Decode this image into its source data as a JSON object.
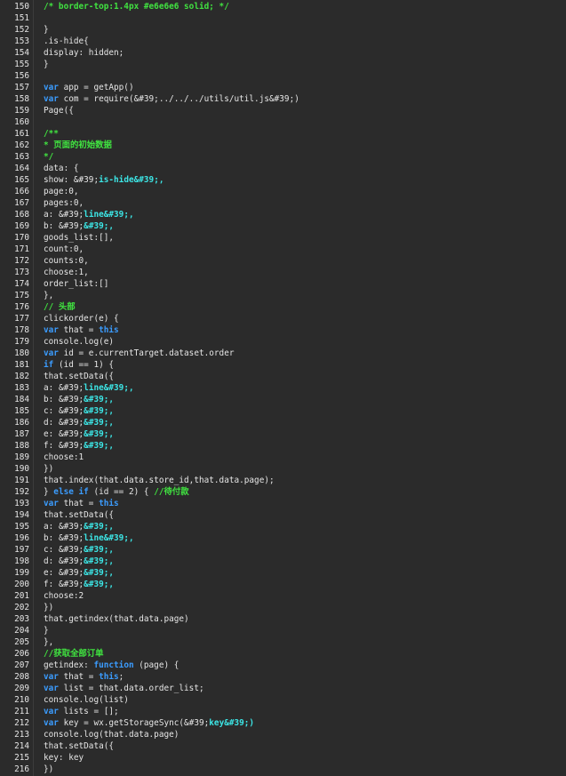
{
  "editor": {
    "colors": {
      "background": "#2b2b2b",
      "text": "#e6e6e6",
      "comment": "#40e340",
      "keyword": "#3b9cff",
      "string": "#3ce6e6"
    },
    "lines": [
      {
        "n": "150",
        "t": [
          [
            "comment",
            "/* border-top:1.4px #e6e6e6 solid; */"
          ]
        ]
      },
      {
        "n": "151",
        "t": []
      },
      {
        "n": "152",
        "t": [
          [
            "plain",
            "}"
          ]
        ]
      },
      {
        "n": "153",
        "t": [
          [
            "plain",
            ".is-hide{"
          ]
        ]
      },
      {
        "n": "154",
        "t": [
          [
            "plain",
            "display: hidden;"
          ]
        ]
      },
      {
        "n": "155",
        "t": [
          [
            "plain",
            "}"
          ]
        ]
      },
      {
        "n": "156",
        "t": []
      },
      {
        "n": "157",
        "t": [
          [
            "kw",
            "var"
          ],
          [
            "plain",
            " app = getApp()"
          ]
        ]
      },
      {
        "n": "158",
        "t": [
          [
            "kw",
            "var"
          ],
          [
            "plain",
            " com = require(&#39;../../../utils/util.js&#39;)"
          ]
        ]
      },
      {
        "n": "159",
        "t": [
          [
            "plain",
            "Page({"
          ]
        ]
      },
      {
        "n": "160",
        "t": []
      },
      {
        "n": "161",
        "t": [
          [
            "comment",
            "/**"
          ]
        ]
      },
      {
        "n": "162",
        "t": [
          [
            "comment",
            "* 页面的初始数据"
          ]
        ]
      },
      {
        "n": "163",
        "t": [
          [
            "comment",
            "*/"
          ]
        ]
      },
      {
        "n": "164",
        "t": [
          [
            "plain",
            "data: {"
          ]
        ]
      },
      {
        "n": "165",
        "t": [
          [
            "plain",
            "show: "
          ],
          [
            "plain",
            "&#39;"
          ],
          [
            "str",
            "is-hide&#39;,"
          ]
        ]
      },
      {
        "n": "166",
        "t": [
          [
            "plain",
            "page:0,"
          ]
        ]
      },
      {
        "n": "167",
        "t": [
          [
            "plain",
            "pages:0,"
          ]
        ]
      },
      {
        "n": "168",
        "t": [
          [
            "plain",
            "a: "
          ],
          [
            "plain",
            "&#39;"
          ],
          [
            "str",
            "line&#39;,"
          ]
        ]
      },
      {
        "n": "169",
        "t": [
          [
            "plain",
            "b: "
          ],
          [
            "plain",
            "&#39;"
          ],
          [
            "str",
            "&#39;,"
          ]
        ]
      },
      {
        "n": "170",
        "t": [
          [
            "plain",
            "goods_list:[],"
          ]
        ]
      },
      {
        "n": "171",
        "t": [
          [
            "plain",
            "count:0,"
          ]
        ]
      },
      {
        "n": "172",
        "t": [
          [
            "plain",
            "counts:0,"
          ]
        ]
      },
      {
        "n": "173",
        "t": [
          [
            "plain",
            "choose:1,"
          ]
        ]
      },
      {
        "n": "174",
        "t": [
          [
            "plain",
            "order_list:[]"
          ]
        ]
      },
      {
        "n": "175",
        "t": [
          [
            "plain",
            "},"
          ]
        ]
      },
      {
        "n": "176",
        "t": [
          [
            "comment",
            "// 头部"
          ]
        ]
      },
      {
        "n": "177",
        "t": [
          [
            "plain",
            "clickorder(e) {"
          ]
        ]
      },
      {
        "n": "178",
        "t": [
          [
            "kw",
            "var"
          ],
          [
            "plain",
            " that = "
          ],
          [
            "kw",
            "this"
          ]
        ]
      },
      {
        "n": "179",
        "t": [
          [
            "plain",
            "console.log(e)"
          ]
        ]
      },
      {
        "n": "180",
        "t": [
          [
            "kw",
            "var"
          ],
          [
            "plain",
            " id = e.currentTarget.dataset.order"
          ]
        ]
      },
      {
        "n": "181",
        "t": [
          [
            "kw",
            "if"
          ],
          [
            "plain",
            " (id == 1) {"
          ]
        ]
      },
      {
        "n": "182",
        "t": [
          [
            "plain",
            "that.setData({"
          ]
        ]
      },
      {
        "n": "183",
        "t": [
          [
            "plain",
            "a: "
          ],
          [
            "plain",
            "&#39;"
          ],
          [
            "str",
            "line&#39;,"
          ]
        ]
      },
      {
        "n": "184",
        "t": [
          [
            "plain",
            "b: "
          ],
          [
            "plain",
            "&#39;"
          ],
          [
            "str",
            "&#39;,"
          ]
        ]
      },
      {
        "n": "185",
        "t": [
          [
            "plain",
            "c: "
          ],
          [
            "plain",
            "&#39;"
          ],
          [
            "str",
            "&#39;,"
          ]
        ]
      },
      {
        "n": "186",
        "t": [
          [
            "plain",
            "d: "
          ],
          [
            "plain",
            "&#39;"
          ],
          [
            "str",
            "&#39;,"
          ]
        ]
      },
      {
        "n": "187",
        "t": [
          [
            "plain",
            "e: "
          ],
          [
            "plain",
            "&#39;"
          ],
          [
            "str",
            "&#39;,"
          ]
        ]
      },
      {
        "n": "188",
        "t": [
          [
            "plain",
            "f: "
          ],
          [
            "plain",
            "&#39;"
          ],
          [
            "str",
            "&#39;,"
          ]
        ]
      },
      {
        "n": "189",
        "t": [
          [
            "plain",
            "choose:1"
          ]
        ]
      },
      {
        "n": "190",
        "t": [
          [
            "plain",
            "})"
          ]
        ]
      },
      {
        "n": "191",
        "t": [
          [
            "plain",
            "that.index(that.data.store_id,that.data.page);"
          ]
        ]
      },
      {
        "n": "192",
        "t": [
          [
            "plain",
            "} "
          ],
          [
            "kw",
            "else if"
          ],
          [
            "plain",
            " (id == 2) { "
          ],
          [
            "comment",
            "//待付款"
          ]
        ]
      },
      {
        "n": "193",
        "t": [
          [
            "kw",
            "var"
          ],
          [
            "plain",
            " that = "
          ],
          [
            "kw",
            "this"
          ]
        ]
      },
      {
        "n": "194",
        "t": [
          [
            "plain",
            "that.setData({"
          ]
        ]
      },
      {
        "n": "195",
        "t": [
          [
            "plain",
            "a: "
          ],
          [
            "plain",
            "&#39;"
          ],
          [
            "str",
            "&#39;,"
          ]
        ]
      },
      {
        "n": "196",
        "t": [
          [
            "plain",
            "b: "
          ],
          [
            "plain",
            "&#39;"
          ],
          [
            "str",
            "line&#39;,"
          ]
        ]
      },
      {
        "n": "197",
        "t": [
          [
            "plain",
            "c: "
          ],
          [
            "plain",
            "&#39;"
          ],
          [
            "str",
            "&#39;,"
          ]
        ]
      },
      {
        "n": "198",
        "t": [
          [
            "plain",
            "d: "
          ],
          [
            "plain",
            "&#39;"
          ],
          [
            "str",
            "&#39;,"
          ]
        ]
      },
      {
        "n": "199",
        "t": [
          [
            "plain",
            "e: "
          ],
          [
            "plain",
            "&#39;"
          ],
          [
            "str",
            "&#39;,"
          ]
        ]
      },
      {
        "n": "200",
        "t": [
          [
            "plain",
            "f: "
          ],
          [
            "plain",
            "&#39;"
          ],
          [
            "str",
            "&#39;,"
          ]
        ]
      },
      {
        "n": "201",
        "t": [
          [
            "plain",
            "choose:2"
          ]
        ]
      },
      {
        "n": "202",
        "t": [
          [
            "plain",
            "})"
          ]
        ]
      },
      {
        "n": "203",
        "t": [
          [
            "plain",
            "that.getindex(that.data.page)"
          ]
        ]
      },
      {
        "n": "204",
        "t": [
          [
            "plain",
            "}"
          ]
        ]
      },
      {
        "n": "205",
        "t": [
          [
            "plain",
            "},"
          ]
        ]
      },
      {
        "n": "206",
        "t": [
          [
            "comment",
            "//获取全部订单"
          ]
        ]
      },
      {
        "n": "207",
        "t": [
          [
            "plain",
            "getindex: "
          ],
          [
            "kw",
            "function"
          ],
          [
            "plain",
            " (page) {"
          ]
        ]
      },
      {
        "n": "208",
        "t": [
          [
            "kw",
            "var"
          ],
          [
            "plain",
            " that = "
          ],
          [
            "kw",
            "this"
          ],
          [
            "plain",
            ";"
          ]
        ]
      },
      {
        "n": "209",
        "t": [
          [
            "kw",
            "var"
          ],
          [
            "plain",
            " list = that.data.order_list;"
          ]
        ]
      },
      {
        "n": "210",
        "t": [
          [
            "plain",
            "console.log(list)"
          ]
        ]
      },
      {
        "n": "211",
        "t": [
          [
            "kw",
            "var"
          ],
          [
            "plain",
            " lists = [];"
          ]
        ]
      },
      {
        "n": "212",
        "t": [
          [
            "kw",
            "var"
          ],
          [
            "plain",
            " key = wx.getStorageSync("
          ],
          [
            "plain",
            "&#39;"
          ],
          [
            "str",
            "key&#39;)"
          ]
        ]
      },
      {
        "n": "213",
        "t": [
          [
            "plain",
            "console.log(that.data.page)"
          ]
        ]
      },
      {
        "n": "214",
        "t": [
          [
            "plain",
            "that.setData({"
          ]
        ]
      },
      {
        "n": "215",
        "t": [
          [
            "plain",
            "key: key"
          ]
        ]
      },
      {
        "n": "216",
        "t": [
          [
            "plain",
            "})"
          ]
        ]
      }
    ]
  }
}
